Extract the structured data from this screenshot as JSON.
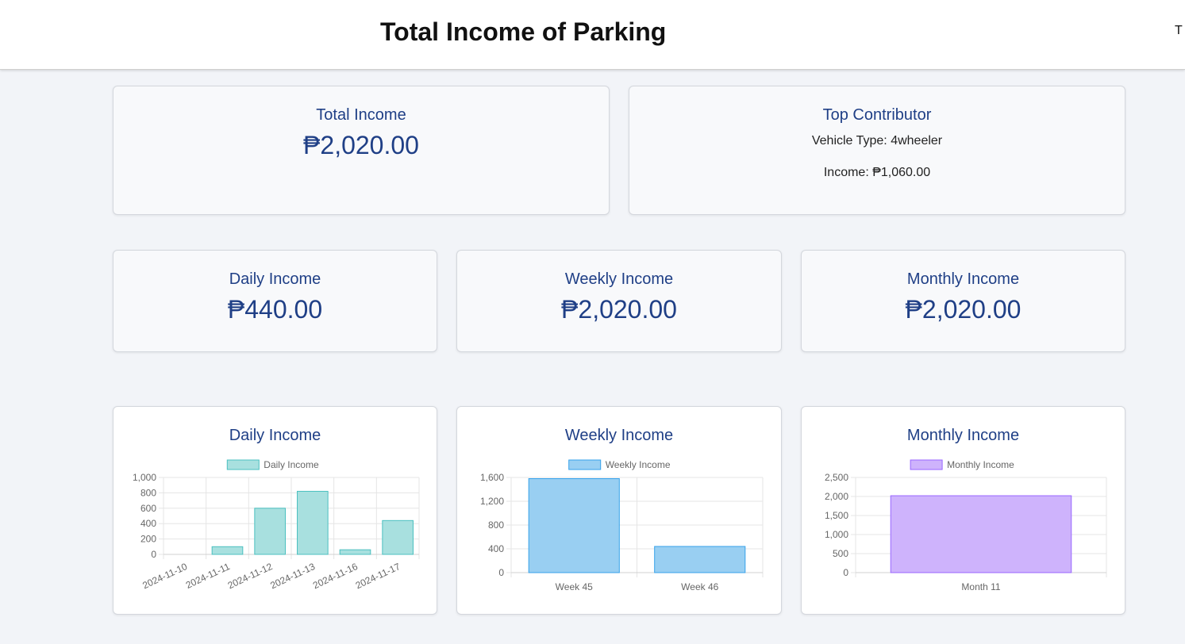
{
  "header": {
    "title": "Total Income of Parking",
    "cut_text": "T"
  },
  "currency": "₱",
  "summary": {
    "total": {
      "label": "Total Income",
      "value": "₱2,020.00"
    },
    "top": {
      "label": "Top Contributor",
      "vehicle": "Vehicle Type: 4wheeler",
      "income": "Income: ₱1,060.00"
    },
    "daily": {
      "label": "Daily Income",
      "value": "₱440.00"
    },
    "weekly": {
      "label": "Weekly Income",
      "value": "₱2,020.00"
    },
    "monthly": {
      "label": "Monthly Income",
      "value": "₱2,020.00"
    }
  },
  "chart_data": [
    {
      "type": "bar",
      "title": "Daily Income",
      "legend": "Daily Income",
      "categories": [
        "2024-11-10",
        "2024-11-11",
        "2024-11-12",
        "2024-11-13",
        "2024-11-16",
        "2024-11-17"
      ],
      "values": [
        0,
        100,
        600,
        820,
        60,
        440
      ],
      "ylim": [
        0,
        1000
      ],
      "yticks": [
        "0",
        "200",
        "400",
        "600",
        "800",
        "1,000"
      ],
      "color": "#a8e0df",
      "border": "#4bc0c0"
    },
    {
      "type": "bar",
      "title": "Weekly Income",
      "legend": "Weekly Income",
      "categories": [
        "Week 45",
        "Week 46"
      ],
      "values": [
        1580,
        440
      ],
      "ylim": [
        0,
        1600
      ],
      "yticks": [
        "0",
        "400",
        "800",
        "1,200",
        "1,600"
      ],
      "color": "#99cff2",
      "border": "#36a2eb"
    },
    {
      "type": "bar",
      "title": "Monthly Income",
      "legend": "Monthly Income",
      "categories": [
        "Month 11"
      ],
      "values": [
        2020
      ],
      "ylim": [
        0,
        2500
      ],
      "yticks": [
        "0",
        "500",
        "1,000",
        "1,500",
        "2,000",
        "2,500"
      ],
      "color": "#ceb3fc",
      "border": "#9966ff"
    }
  ]
}
